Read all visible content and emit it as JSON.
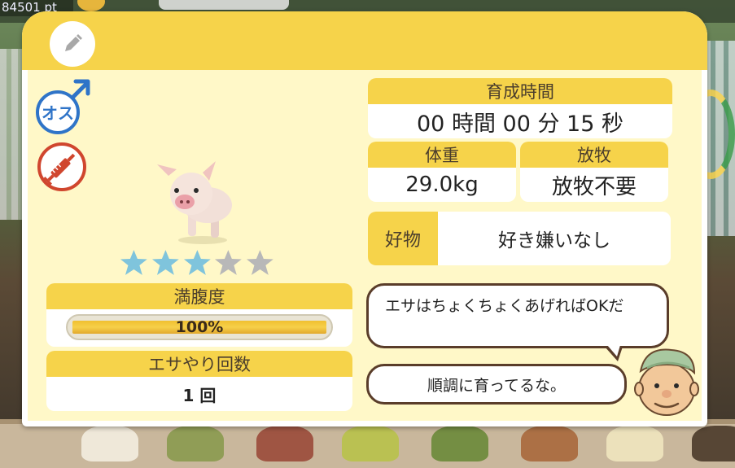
{
  "background": {
    "points_text": "84501 pt"
  },
  "dialog": {
    "edit_icon": "pencil-icon",
    "gender_icon": "male-symbol-icon",
    "gender_label": "オス",
    "vaccine_icon": "syringe-icon",
    "animal": "pig",
    "stars": {
      "filled": 3,
      "total": 5
    },
    "fullness": {
      "label": "満腹度",
      "value_text": "100%",
      "percent": 100
    },
    "feed_count": {
      "label": "エサやり回数",
      "value": "1 回"
    },
    "grow_time": {
      "label": "育成時間",
      "value": "00 時間 00 分 15 秒"
    },
    "weight": {
      "label": "体重",
      "value": "29.0kg"
    },
    "grazing": {
      "label": "放牧",
      "value": "放牧不要"
    },
    "favorite": {
      "label": "好物",
      "value": "好き嫌いなし"
    },
    "message_1": "エサはちょくちょくあげればOKだ",
    "message_2": "順調に育ってるな。"
  },
  "colors": {
    "accent": "#f6d34a",
    "panel": "#fff8c8",
    "star_filled": "#7fc4dc",
    "star_empty": "#b8b8b8",
    "male_blue": "#2f74c8",
    "vaccine_red": "#d0462e"
  }
}
